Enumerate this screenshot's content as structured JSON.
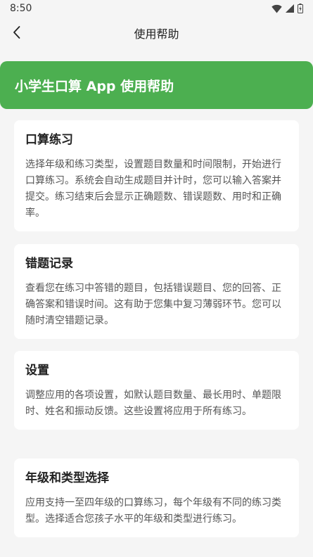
{
  "status_bar": {
    "time": "8:50",
    "icons": [
      "wifi-icon",
      "signal-icon",
      "battery-icon"
    ]
  },
  "app_bar": {
    "title": "使用帮助",
    "back_icon": "chevron-left-icon"
  },
  "banner": {
    "title": "小学生口算 App 使用帮助",
    "color": "#4caf50"
  },
  "sections": [
    {
      "title": "口算练习",
      "body": "选择年级和练习类型，设置题目数量和时间限制，开始进行口算练习。系统会自动生成题目并计时，您可以输入答案并提交。练习结束后会显示正确题数、错误题数、用时和正确率。"
    },
    {
      "title": "错题记录",
      "body": "查看您在练习中答错的题目，包括错误题目、您的回答、正确答案和错误时间。这有助于您集中复习薄弱环节。您可以随时清空错题记录。"
    },
    {
      "title": "设置",
      "body": "调整应用的各项设置，如默认题目数量、最长用时、单题限时、姓名和振动反馈。这些设置将应用于所有练习。"
    },
    {
      "title": "年级和类型选择",
      "body": "应用支持一至四年级的口算练习，每个年级有不同的练习类型。选择适合您孩子水平的年级和类型进行练习。"
    }
  ]
}
